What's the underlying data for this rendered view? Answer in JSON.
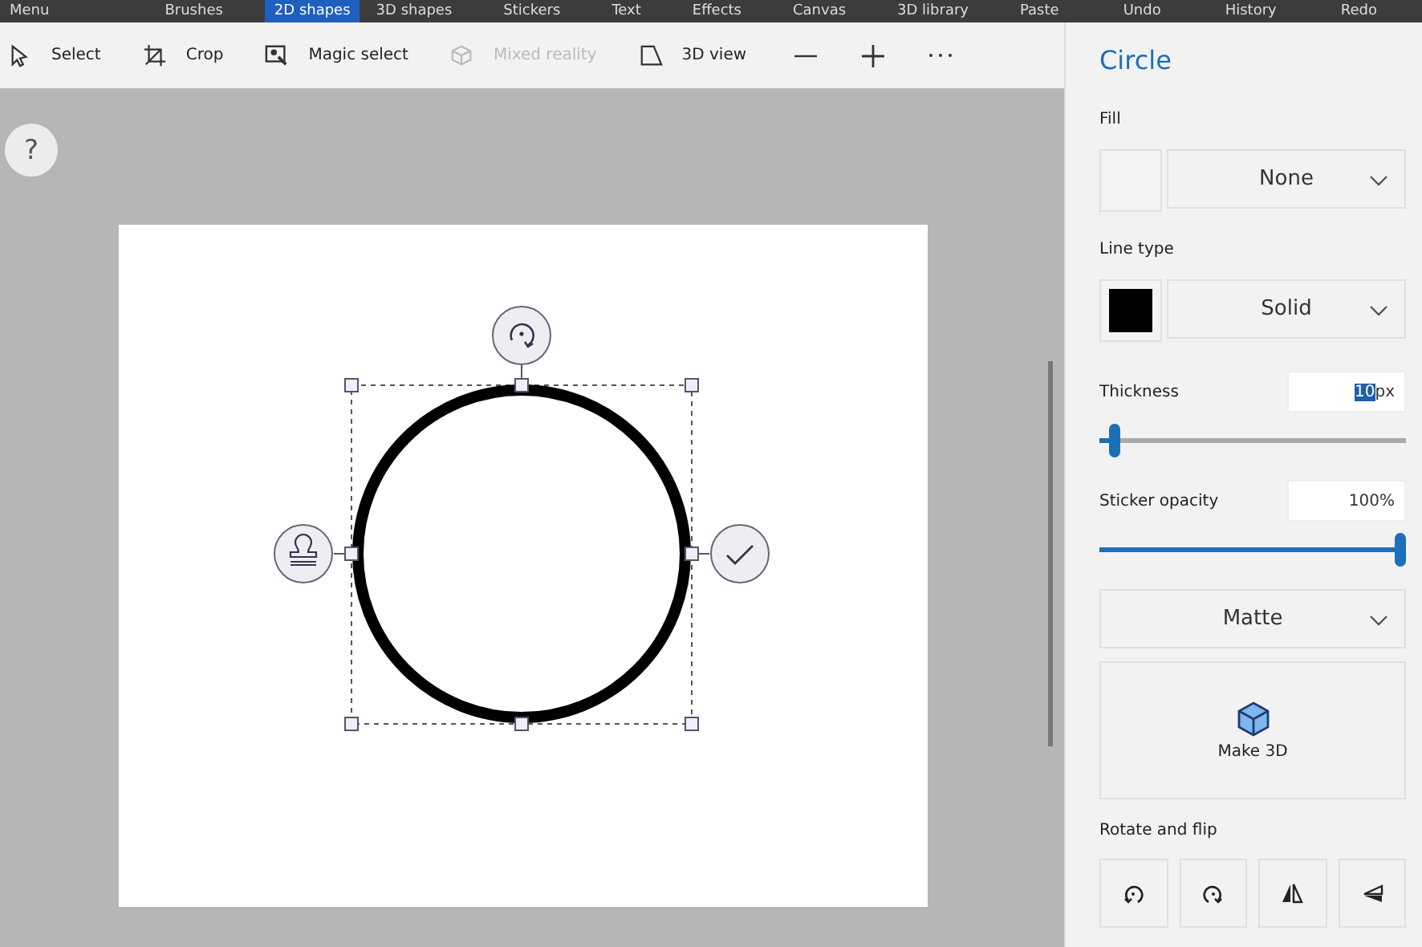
{
  "menu_bar": {
    "tabs": [
      {
        "label": "Menu",
        "selected": false
      },
      {
        "label": "Brushes",
        "selected": false
      },
      {
        "label": "2D shapes",
        "selected": true
      },
      {
        "label": "3D shapes",
        "selected": false
      },
      {
        "label": "Stickers",
        "selected": false
      },
      {
        "label": "Text",
        "selected": false
      },
      {
        "label": "Effects",
        "selected": false
      },
      {
        "label": "Canvas",
        "selected": false
      },
      {
        "label": "3D library",
        "selected": false
      }
    ],
    "actions": [
      {
        "label": "Paste"
      },
      {
        "label": "Undo"
      },
      {
        "label": "History"
      },
      {
        "label": "Redo"
      }
    ]
  },
  "toolbar": {
    "items": [
      {
        "kind": "select",
        "label": "Select",
        "disabled": false
      },
      {
        "kind": "crop",
        "label": "Crop",
        "disabled": false
      },
      {
        "kind": "magic",
        "label": "Magic select",
        "disabled": false
      },
      {
        "kind": "mixed",
        "label": "Mixed reality",
        "disabled": true
      },
      {
        "kind": "view3d",
        "label": "3D view",
        "disabled": false
      }
    ],
    "zoom_buttons": [
      {
        "kind": "minus"
      },
      {
        "kind": "plus"
      },
      {
        "kind": "more"
      }
    ]
  },
  "help": {
    "label": "?"
  },
  "panel": {
    "title": "Circle",
    "fill": {
      "label": "Fill",
      "value": "None"
    },
    "line_type": {
      "label": "Line type",
      "value": "Solid"
    },
    "thickness": {
      "label": "Thickness",
      "value": "10",
      "unit": "px",
      "highlighted": true,
      "level": 0.05
    },
    "opacity": {
      "label": "Sticker opacity",
      "value": "100%",
      "level": 1.0
    },
    "finish": {
      "value": "Matte"
    },
    "make3d": {
      "label": "Make 3D"
    },
    "rotate": {
      "label": "Rotate and flip",
      "buttons": [
        {
          "kind": "rotate-left"
        },
        {
          "kind": "rotate-right"
        },
        {
          "kind": "flip-horizontal"
        },
        {
          "kind": "flip-vertical"
        }
      ]
    }
  }
}
